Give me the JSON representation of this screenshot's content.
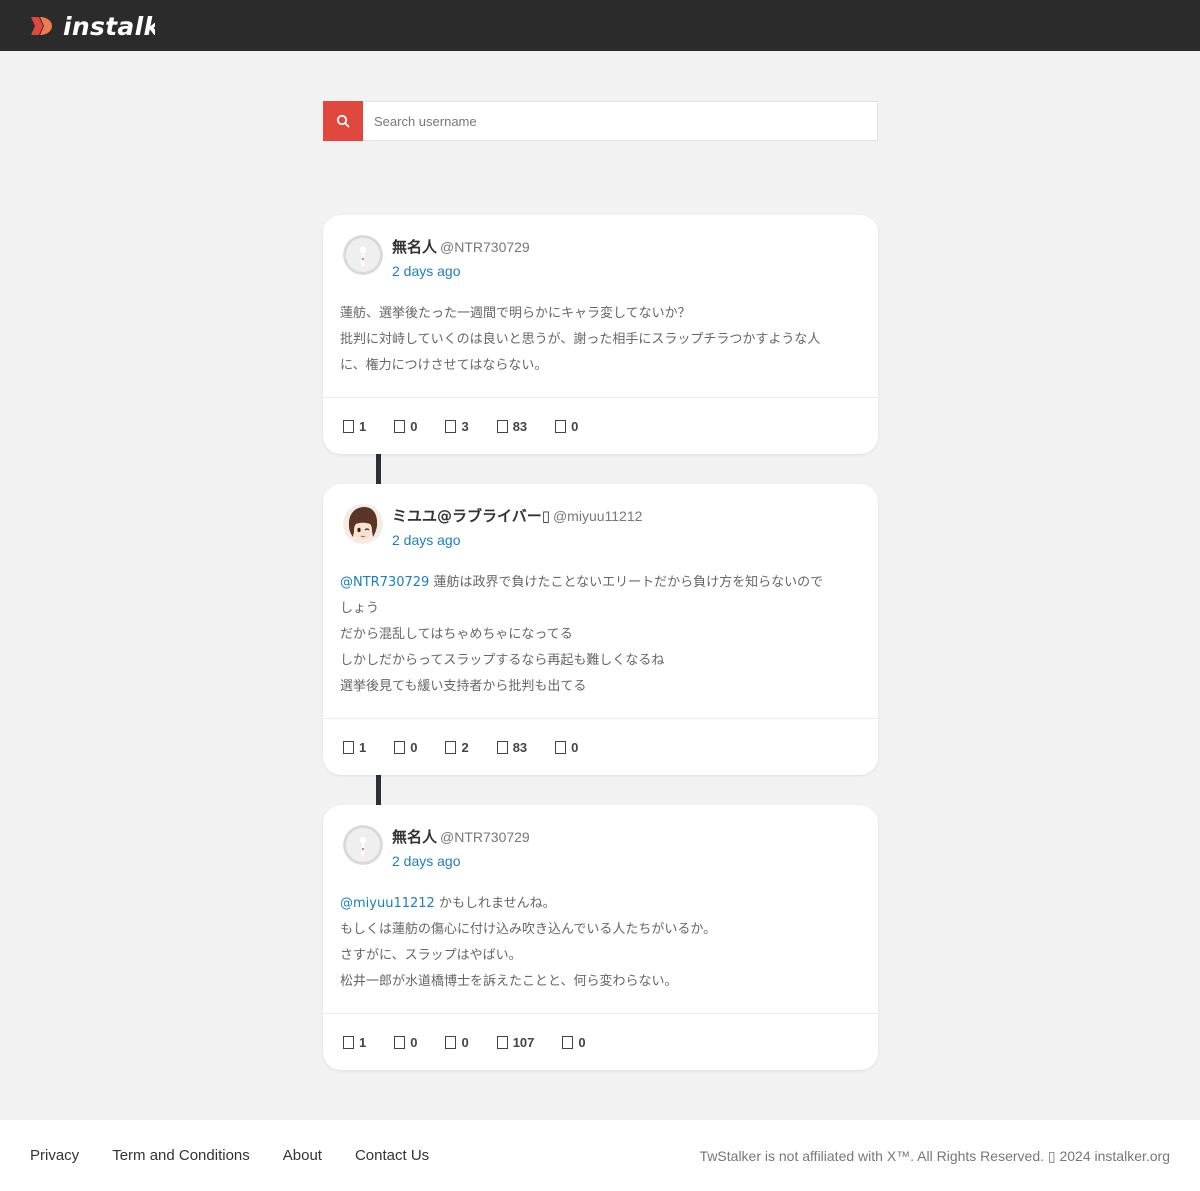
{
  "header": {
    "logo_text": "instalk",
    "brand_color": "#e0483e",
    "background": "#2b2b2b"
  },
  "search": {
    "placeholder": "Search username",
    "icon": "search-icon",
    "value": ""
  },
  "posts": [
    {
      "display_name": "無名人",
      "handle": "@NTR730729",
      "time": "2 days ago",
      "avatar": "default-avatar",
      "mention": "",
      "lines": [
        "蓮舫、選挙後たった一週間で明らかにキャラ変してないか？",
        "批判に対峙していくのは良いと思うが、謝った相手にスラップチラつかすような人",
        "に、権力につけさせてはならない。"
      ],
      "stats": {
        "replies": "1",
        "retweets": "0",
        "quotes": "3",
        "views": "83",
        "likes": "0"
      }
    },
    {
      "display_name": "ミユユ@ラブライバー",
      "name_suffix": "▯",
      "handle": "@miyuu11212",
      "time": "2 days ago",
      "avatar": "anime-avatar",
      "mention": "@NTR730729",
      "lines": [
        "蓮舫は政界で負けたことないエリートだから負け方を知らないので",
        "しょう",
        "だから混乱してはちゃめちゃになってる",
        "しかしだからってスラップするなら再起も難しくなるね",
        "選挙後見ても緩い支持者から批判も出てる"
      ],
      "stats": {
        "replies": "1",
        "retweets": "0",
        "quotes": "2",
        "views": "83",
        "likes": "0"
      }
    },
    {
      "display_name": "無名人",
      "handle": "@NTR730729",
      "time": "2 days ago",
      "avatar": "default-avatar",
      "mention": "@miyuu11212",
      "lines": [
        "かもしれませんね。",
        "もしくは蓮舫の傷心に付け込み吹き込んでいる人たちがいるか。",
        "さすがに、スラップはやばい。",
        "松井一郎が水道橋博士を訴えたことと、何ら変わらない。"
      ],
      "stats": {
        "replies": "1",
        "retweets": "0",
        "quotes": "0",
        "views": "107",
        "likes": "0"
      }
    }
  ],
  "footer": {
    "links": [
      "Privacy",
      "Term and Conditions",
      "About",
      "Contact Us"
    ],
    "copyright": "TwStalker is not affiliated with X™. All Rights Reserved. ▯ 2024 instalker.org"
  },
  "colors": {
    "link": "#1a7fc0",
    "page_bg": "#f2f2f2",
    "connector": "#2b303a"
  }
}
